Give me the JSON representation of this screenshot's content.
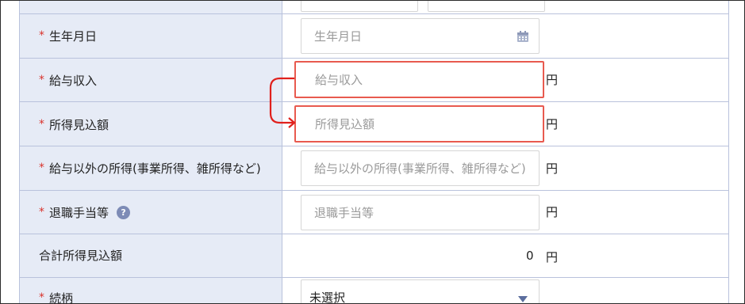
{
  "form": {
    "rows": [
      {
        "label": "生年月日",
        "required": true,
        "placeholder": "生年月日"
      },
      {
        "label": "給与収入",
        "required": true,
        "placeholder": "給与収入",
        "unit": "円"
      },
      {
        "label": "所得見込額",
        "required": true,
        "placeholder": "所得見込額",
        "unit": "円"
      },
      {
        "label": "給与以外の所得(事業所得、雑所得など)",
        "required": true,
        "placeholder": "給与以外の所得(事業所得、雑所得など)",
        "unit": "円"
      },
      {
        "label": "退職手当等",
        "required": true,
        "placeholder": "退職手当等",
        "unit": "円",
        "help": "?"
      },
      {
        "label": "合計所得見込額",
        "required": false,
        "value": "0",
        "unit": "円"
      },
      {
        "label": "続柄",
        "required": true,
        "selected": "未選択"
      }
    ],
    "required_mark": "*"
  },
  "colors": {
    "label_bg": "#e6ebf6",
    "border": "#b9c2dc",
    "required": "#d9322b",
    "highlight": "#e85a4f",
    "arrow": "#e0201c"
  }
}
